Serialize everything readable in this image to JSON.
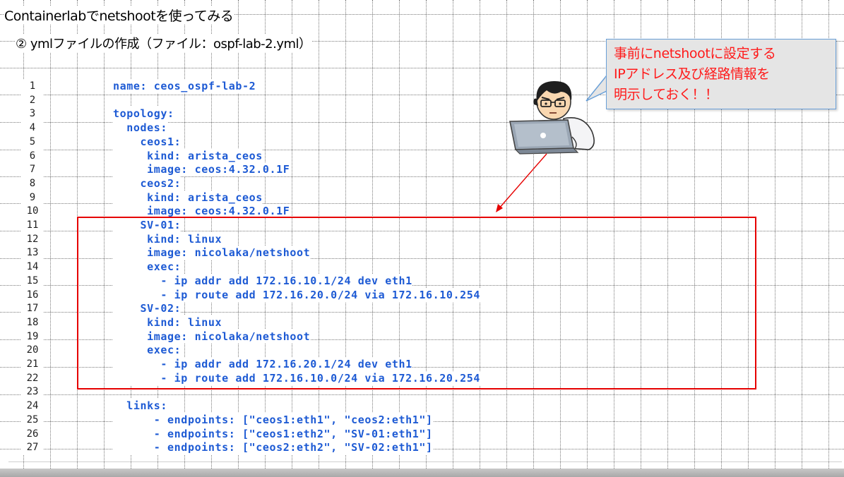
{
  "slide": {
    "title": "Containerlabでnetshootを使ってみる",
    "subtitle": "②  ymlファイルの作成（ファイル：ospf-lab-2.yml）"
  },
  "callout": {
    "lines": [
      "事前にnetshootに設定する",
      "IPアドレス及び経路情報を",
      "明示しておく！！"
    ]
  },
  "code": {
    "lines": [
      {
        "n": "1",
        "text": "name: ceos_ospf-lab-2"
      },
      {
        "n": "2",
        "text": ""
      },
      {
        "n": "3",
        "text": "topology:"
      },
      {
        "n": "4",
        "text": "  nodes:"
      },
      {
        "n": "5",
        "text": "    ceos1:"
      },
      {
        "n": "6",
        "text": "     kind: arista_ceos"
      },
      {
        "n": "7",
        "text": "     image: ceos:4.32.0.1F"
      },
      {
        "n": "8",
        "text": "    ceos2:"
      },
      {
        "n": "9",
        "text": "     kind: arista_ceos"
      },
      {
        "n": "10",
        "text": "     image: ceos:4.32.0.1F"
      },
      {
        "n": "11",
        "text": "    SV-01:"
      },
      {
        "n": "12",
        "text": "     kind: linux"
      },
      {
        "n": "13",
        "text": "     image: nicolaka/netshoot"
      },
      {
        "n": "14",
        "text": "     exec:"
      },
      {
        "n": "15",
        "text": "       - ip addr add 172.16.10.1/24 dev eth1"
      },
      {
        "n": "16",
        "text": "       - ip route add 172.16.20.0/24 via 172.16.10.254"
      },
      {
        "n": "17",
        "text": "    SV-02:"
      },
      {
        "n": "18",
        "text": "     kind: linux"
      },
      {
        "n": "19",
        "text": "     image: nicolaka/netshoot"
      },
      {
        "n": "20",
        "text": "     exec:"
      },
      {
        "n": "21",
        "text": "       - ip addr add 172.16.20.1/24 dev eth1"
      },
      {
        "n": "22",
        "text": "       - ip route add 172.16.10.0/24 via 172.16.20.254"
      },
      {
        "n": "23",
        "text": ""
      },
      {
        "n": "24",
        "text": "  links:"
      },
      {
        "n": "25",
        "text": "      - endpoints: [\"ceos1:eth1\", \"ceos2:eth1\"]"
      },
      {
        "n": "26",
        "text": "      - endpoints: [\"ceos1:eth2\", \"SV-01:eth1\"]"
      },
      {
        "n": "27",
        "text": "      - endpoints: [\"ceos2:eth2\", \"SV-02:eth1\"]"
      }
    ]
  },
  "colors": {
    "code_text": "#1d5ad4",
    "highlight_border": "#e60000",
    "callout_text": "#ff1a1a",
    "callout_bg": "#e5e5e5"
  },
  "icons": [
    "person-at-laptop-illustration",
    "arrow-icon"
  ]
}
